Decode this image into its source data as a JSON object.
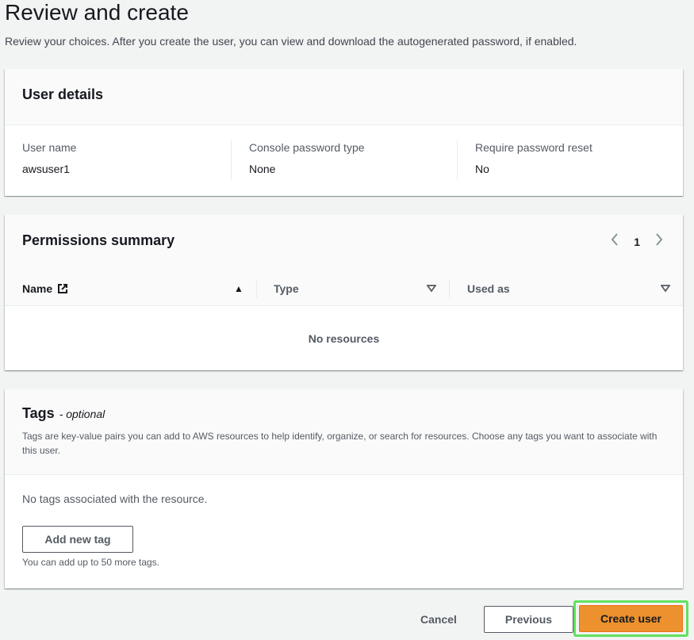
{
  "page": {
    "title": "Review and create",
    "description": "Review your choices. After you create the user, you can view and download the autogenerated password, if enabled."
  },
  "user_details": {
    "title": "User details",
    "fields": [
      {
        "key": "User name",
        "value": "awsuser1"
      },
      {
        "key": "Console password type",
        "value": "None"
      },
      {
        "key": "Require password reset",
        "value": "No"
      }
    ]
  },
  "permissions": {
    "title": "Permissions summary",
    "page_number": "1",
    "columns": [
      "Name",
      "Type",
      "Used as"
    ],
    "empty_text": "No resources"
  },
  "tags": {
    "title": "Tags",
    "optional_label": "- optional",
    "description": "Tags are key-value pairs you can add to AWS resources to help identify, organize, or search for resources. Choose any tags you want to associate with this user.",
    "empty_text": "No tags associated with the resource.",
    "add_button": "Add new tag",
    "hint": "You can add up to 50 more tags."
  },
  "footer": {
    "cancel": "Cancel",
    "previous": "Previous",
    "create": "Create user"
  },
  "colors": {
    "primary_button": "#ec912d",
    "highlight_outline": "#5fe35f"
  }
}
